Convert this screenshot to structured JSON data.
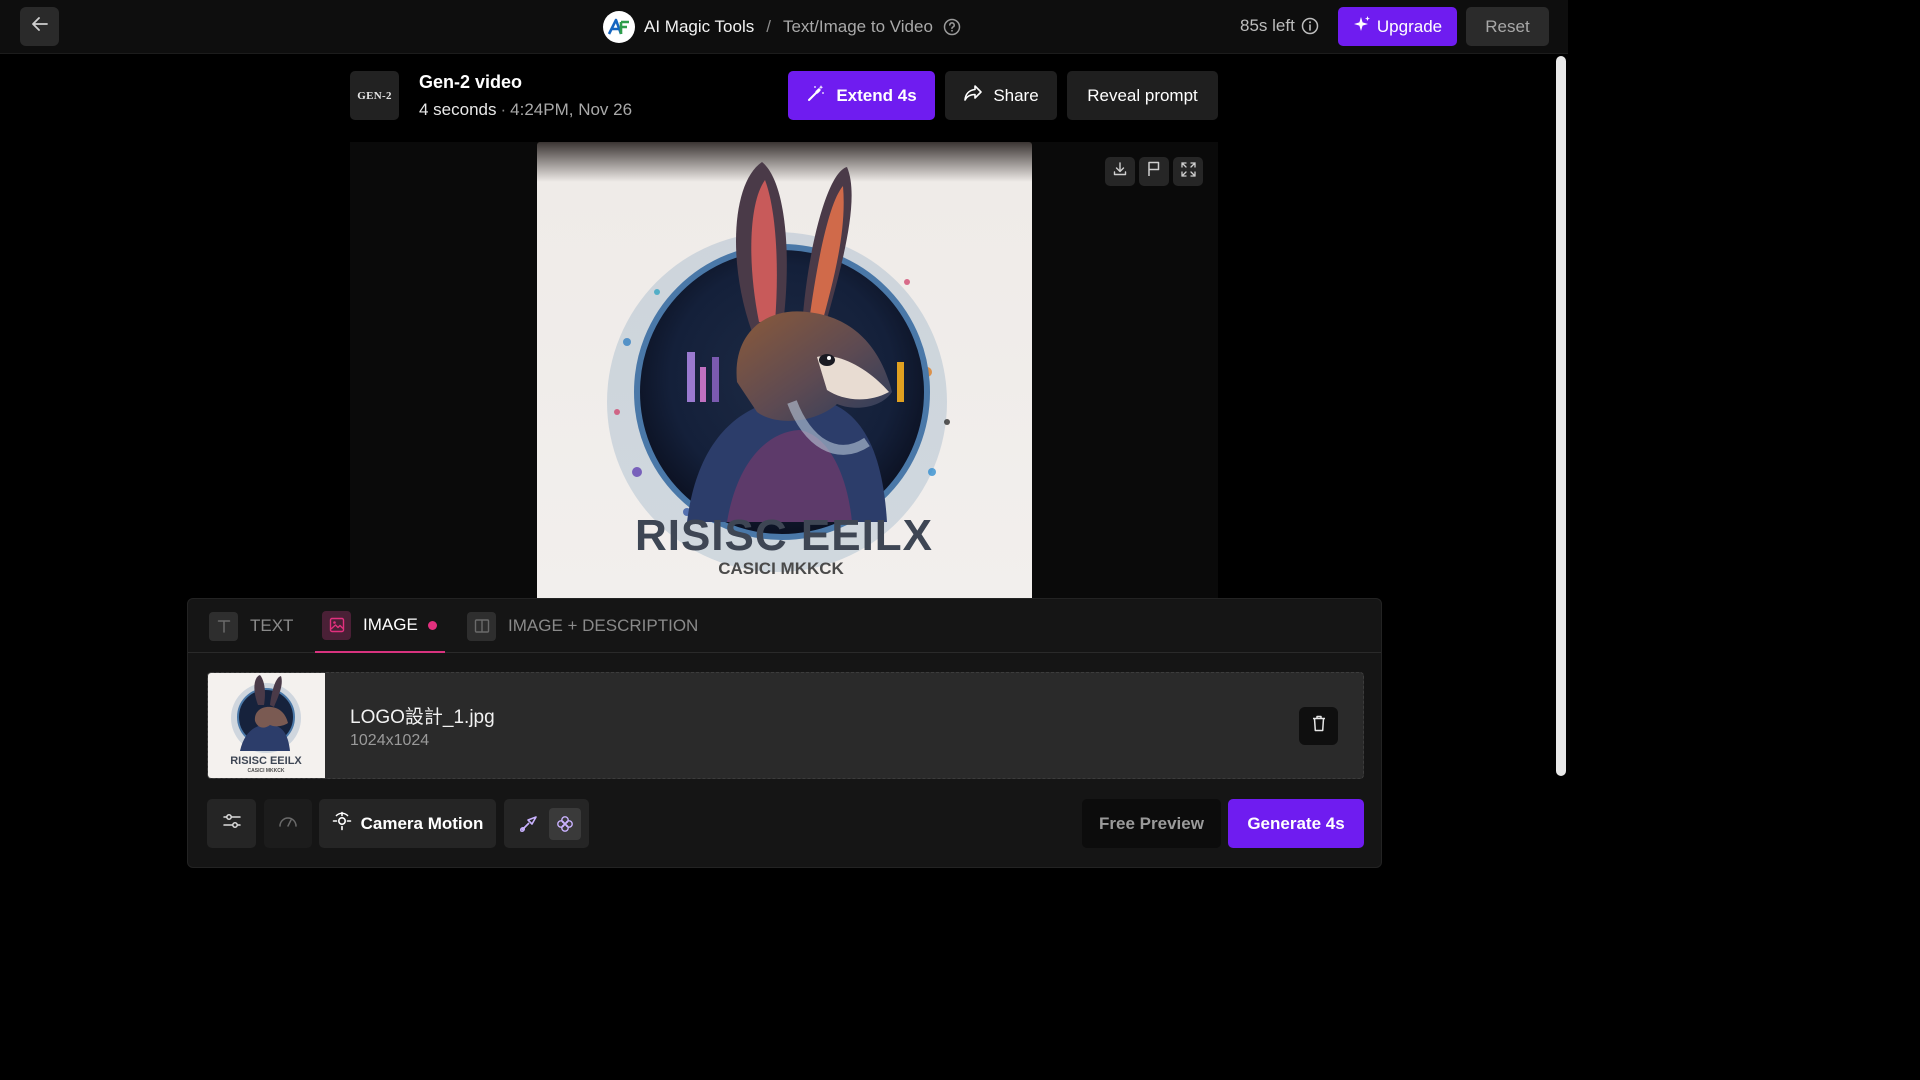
{
  "topbar": {
    "back_icon": "arrow-left-icon",
    "app_name": "AI Magic Tools",
    "separator": "/",
    "page_name": "Text/Image to Video",
    "help_icon": "question-circle-icon",
    "credits_left": "85s left",
    "info_icon": "info-circle-icon",
    "upgrade_label": "Upgrade",
    "upgrade_icon": "sparkle-icon",
    "reset_label": "Reset",
    "accent_color": "#6f1cf0"
  },
  "video": {
    "badge": "GEN-2",
    "title": "Gen-2 video",
    "duration": "4 seconds",
    "meta_sep": "·",
    "created": "4:24PM, Nov 26",
    "extend_label": "Extend 4s",
    "extend_icon": "magic-wand-icon",
    "share_label": "Share",
    "share_icon": "share-arrow-icon",
    "reveal_label": "Reveal prompt",
    "tools": [
      "download-icon",
      "flag-icon",
      "fullscreen-icon"
    ],
    "image_logo_text": "RISISC EEILX",
    "image_logo_subtext": "CASICI MKKCK"
  },
  "panel": {
    "tabs": [
      {
        "label": "TEXT",
        "icon": "text-t-icon",
        "active": false
      },
      {
        "label": "IMAGE",
        "icon": "image-icon",
        "active": true
      },
      {
        "label": "IMAGE + DESCRIPTION",
        "icon": "split-panel-icon",
        "active": false
      }
    ],
    "file": {
      "name": "LOGO設計_1.jpg",
      "dimensions": "1024x1024",
      "thumb_logo_text": "RISISC EEILX",
      "thumb_logo_subtext": "CASICI MKKCK"
    },
    "delete_icon": "trash-icon",
    "toolbar": {
      "settings_icon": "sliders-icon",
      "speed_icon": "gauge-icon",
      "camera_label": "Camera Motion",
      "camera_icon": "camera-motion-icon",
      "brush_icon": "brush-icon",
      "motion_icon": "flower-icon",
      "preview_label": "Free Preview",
      "generate_label": "Generate 4s"
    }
  }
}
